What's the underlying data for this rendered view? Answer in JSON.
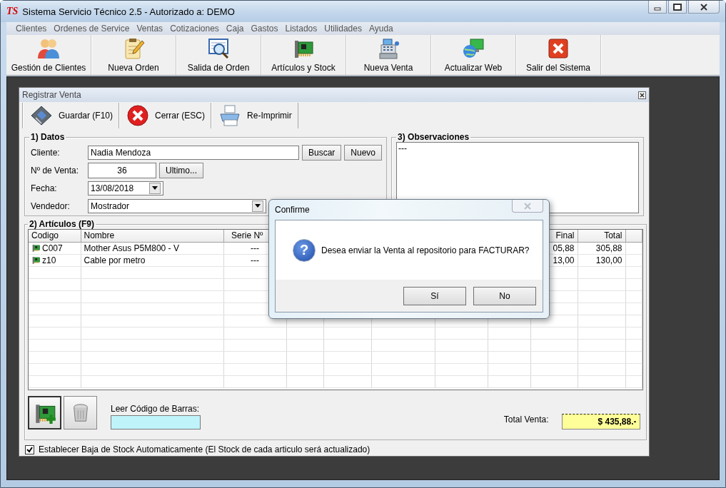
{
  "window": {
    "logo": "TS",
    "title": "Sistema Servicio Técnico 2.5 - Autorizado a: DEMO"
  },
  "menu": [
    "Clientes",
    "Ordenes de Service",
    "Ventas",
    "Cotizaciones",
    "Caja",
    "Gastos",
    "Listados",
    "Utilidades",
    "Ayuda"
  ],
  "toolbar": [
    {
      "label": "Gestión de Clientes",
      "kind": "people"
    },
    {
      "label": "Nueva Orden",
      "kind": "notepad"
    },
    {
      "label": "Salida de Orden",
      "kind": "inspect"
    },
    {
      "label": "Artículos y Stock",
      "kind": "card"
    },
    {
      "label": "Nueva Venta",
      "kind": "register"
    },
    {
      "label": "Actualizar Web",
      "kind": "web"
    },
    {
      "label": "Salir del Sistema",
      "kind": "exit"
    }
  ],
  "child_window": {
    "title": "Registrar Venta",
    "toolbar": [
      {
        "label": "Guardar (F10)",
        "kind": "save"
      },
      {
        "label": "Cerrar (ESC)",
        "kind": "close"
      },
      {
        "label": "Re-Imprimir",
        "kind": "print"
      }
    ],
    "datos": {
      "legend": "1) Datos",
      "cliente": {
        "label": "Cliente:",
        "value": "Nadia Mendoza",
        "buttons": [
          "Buscar",
          "Nuevo"
        ]
      },
      "venta": {
        "label": "Nº de Venta:",
        "value": "36",
        "button": "Ultimo..."
      },
      "fecha": {
        "label": "Fecha:",
        "value": "13/08/2018"
      },
      "vendedor": {
        "label": "Vendedor:",
        "value": "Mostrador"
      }
    },
    "observaciones": {
      "legend": "3) Observaciones",
      "value": "---"
    },
    "articulos": {
      "legend": "2) Artículos (F9)",
      "columns": [
        "Codigo",
        "Nombre",
        "Serie Nº",
        "Final",
        "Total"
      ],
      "rows": [
        {
          "cells": [
            "C007",
            "Mother Asus P5M800 - V",
            "---",
            "05,88",
            "305,88"
          ]
        },
        {
          "cells": [
            "z10",
            "Cable por metro",
            "---",
            "13,00",
            "130,00"
          ]
        }
      ],
      "barcode_label": "Leer Código de Barras:",
      "total_label": "Total Venta:",
      "total_value": "$ 435,88.-"
    },
    "stock_checkbox": {
      "label": "Establecer Baja de Stock Automaticamente (El Stock de cada articulo será actualizado)",
      "checked": true
    }
  },
  "dialog": {
    "title": "Confirme",
    "icon": "?",
    "message": "Desea enviar la Venta al repositorio para FACTURAR?",
    "buttons": [
      "Sí",
      "No"
    ]
  }
}
